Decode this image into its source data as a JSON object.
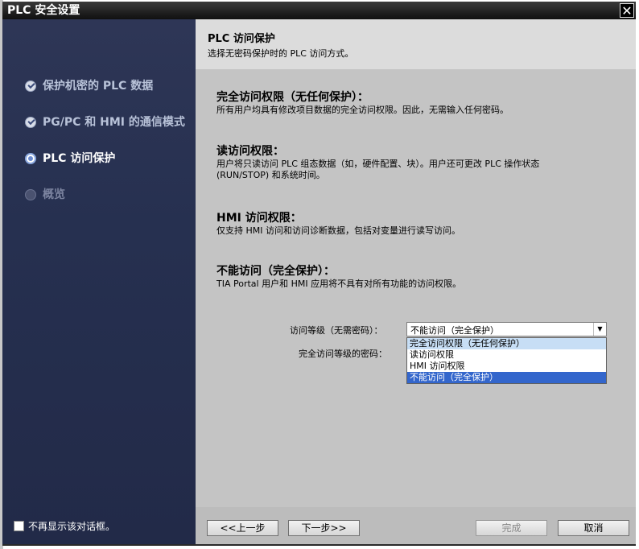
{
  "window": {
    "title": "PLC 安全设置",
    "close_icon": "close-icon"
  },
  "sidebar": {
    "steps": [
      {
        "label": "保护机密的 PLC 数据",
        "state": "done",
        "icon": "check-circle-icon"
      },
      {
        "label": "PG/PC 和 HMI 的通信模式",
        "state": "done",
        "icon": "check-circle-icon"
      },
      {
        "label": "PLC 访问保护",
        "state": "current",
        "icon": "radio-current-icon"
      },
      {
        "label": "概览",
        "state": "todo",
        "icon": "radio-pending-icon"
      }
    ],
    "dont_show_label": "不再显示该对话框。",
    "dont_show_checked": false
  },
  "header": {
    "title": "PLC 访问保护",
    "subtitle": "选择无密码保护时的 PLC 访问方式。"
  },
  "sections": [
    {
      "title": "完全访问权限（无任何保护）：",
      "desc": [
        "所有用户均具有修改项目数据的完全访问权限。因此，无需输入任何密码。"
      ]
    },
    {
      "title": "读访问权限：",
      "desc": [
        "用户将只读访问 PLC 组态数据（如，硬件配置、块）。用户还可更改 PLC 操作状态",
        "(RUN/STOP) 和系统时间。"
      ]
    },
    {
      "title": "HMI 访问权限：",
      "desc": [
        "仅支持 HMI 访问和访问诊断数据，包括对变量进行读写访问。"
      ]
    },
    {
      "title": "不能访问（完全保护）：",
      "desc": [
        "TIA Portal 用户和 HMI 应用将不具有对所有功能的访问权限。"
      ]
    }
  ],
  "form": {
    "access_level_label": "访问等级（无需密码）：",
    "access_level_value": "不能访问（完全保护）",
    "password_label": "完全访问等级的密码：",
    "options": [
      {
        "label": "完全访问权限（无任何保护）",
        "state": "hover"
      },
      {
        "label": "读访问权限",
        "state": ""
      },
      {
        "label": "HMI 访问权限",
        "state": ""
      },
      {
        "label": "不能访问（完全保护）",
        "state": "selected"
      }
    ]
  },
  "footer": {
    "back": "<<上一步",
    "next": "下一步>>",
    "finish": "完成",
    "cancel": "取消"
  }
}
